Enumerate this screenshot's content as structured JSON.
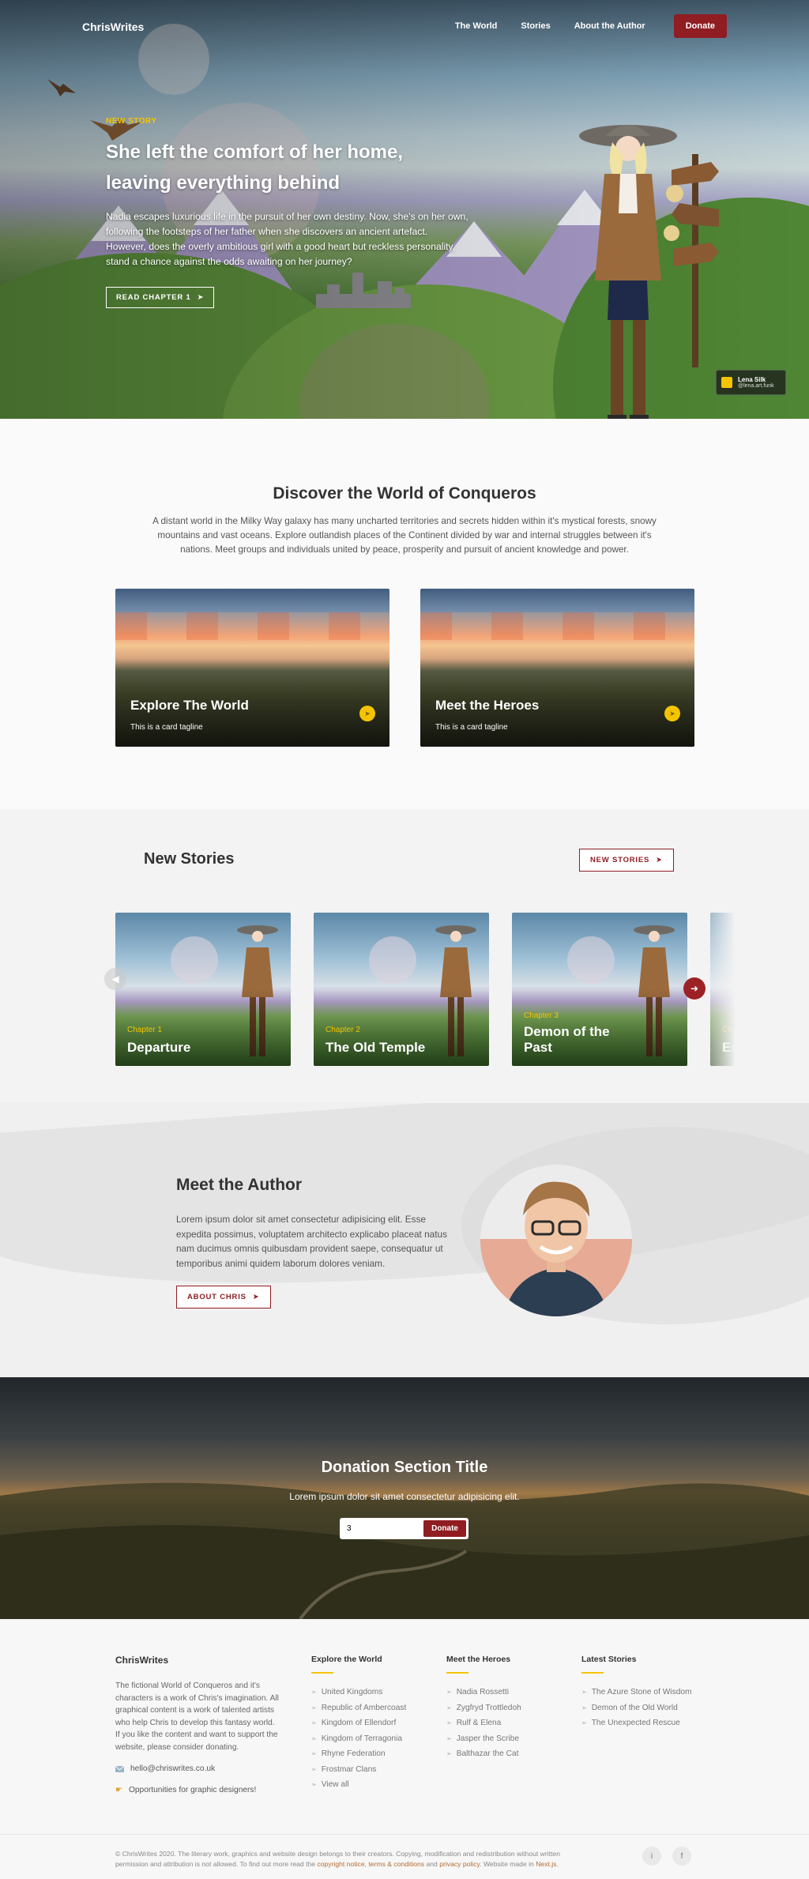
{
  "header": {
    "logo": "ChrisWrites",
    "nav": [
      "The World",
      "Stories",
      "About the Author"
    ],
    "donate_label": "Donate"
  },
  "hero": {
    "tag": "NEW STORY",
    "title": "She left the comfort of her home, leaving everything behind",
    "description": "Nadia escapes luxurious life in the pursuit of her own destiny. Now, she's on her own, following the footsteps of her father when she discovers an ancient artefact. However, does the overly ambitious girl with a good heart but reckless personality, stand a chance against the odds awaiting on her journey?",
    "cta_label": "READ CHAPTER 1",
    "credit": {
      "name": "Lena Silk",
      "handle": "@lena.art.funk"
    }
  },
  "discover": {
    "title": "Discover the World of Conqueros",
    "description": "A distant world in the Milky Way galaxy has many uncharted territories and secrets hidden within it's mystical forests, snowy mountains and vast oceans. Explore outlandish places of the Continent divided by war and internal struggles between it's nations. Meet groups and individuals united by peace, prosperity and pursuit of ancient knowledge and power.",
    "cards": [
      {
        "title": "Explore The World",
        "tagline": "This is a card tagline"
      },
      {
        "title": "Meet the Heroes",
        "tagline": "This is a card tagline"
      }
    ]
  },
  "stories": {
    "title": "New Stories",
    "button_label": "NEW STORIES",
    "items": [
      {
        "chapter": "Chapter 1",
        "title": "Departure"
      },
      {
        "chapter": "Chapter 2",
        "title": "The Old Temple"
      },
      {
        "chapter": "Chapter 3",
        "title": "Demon of the Past"
      },
      {
        "chapter": "Ch",
        "title": "Es"
      }
    ]
  },
  "author": {
    "title": "Meet the Author",
    "description": "Lorem ipsum dolor sit amet consectetur adipisicing elit. Esse expedita possimus, voluptatem architecto explicabo placeat natus nam ducimus omnis quibusdam provident saepe, consequatur ut temporibus animi quidem laborum dolores veniam.",
    "button_label": "ABOUT CHRIS"
  },
  "donation": {
    "title": "Donation Section Title",
    "description": "Lorem ipsum dolor sit amet consectetur adipisicing elit.",
    "amount": "3",
    "button_label": "Donate"
  },
  "footer": {
    "brand": "ChrisWrites",
    "about": "The fictional World of Conqueros and it's characters is a work of Chris's imagination. All graphical content is a work of talented artists who help Chris to develop this fantasy world. If you like the content and want to support the website, please consider donating.",
    "email": "hello@chriswrites.co.uk",
    "opportunities": "Opportunities for graphic designers!",
    "columns": [
      {
        "title": "Explore the World",
        "links": [
          "United Kingdoms",
          "Republic of Ambercoast",
          "Kingdom of Ellendorf",
          "Kingdom of Terragonia",
          "Rhyne Federation",
          "Frostmar Clans",
          "View all"
        ]
      },
      {
        "title": "Meet the Heroes",
        "links": [
          "Nadia Rossetti",
          "Zygfryd Trottledoh",
          "Rulf & Elena",
          "Jasper the Scribe",
          "Balthazar the Cat"
        ]
      },
      {
        "title": "Latest Stories",
        "links": [
          "The Azure Stone of Wisdom",
          "Demon of the Old World",
          "The Unexpected Rescue"
        ]
      }
    ],
    "legal_1": "© ChrisWrites 2020. The literary work, graphics and website design belongs to their creators. Copying, modification and redistribution without written permission and attribution is not allowed. To find out more read the",
    "legal_link_1": "copyright notice",
    "legal_sep_1": ",",
    "legal_link_2": "terms & conditions",
    "legal_and": "and",
    "legal_link_3": "privacy policy",
    "legal_2": ". Website made in",
    "legal_link_4": "Next.js",
    "legal_end": ".",
    "social": [
      "i",
      "f"
    ]
  },
  "colors": {
    "accent": "#8f1d22",
    "highlight": "#f4c400"
  }
}
